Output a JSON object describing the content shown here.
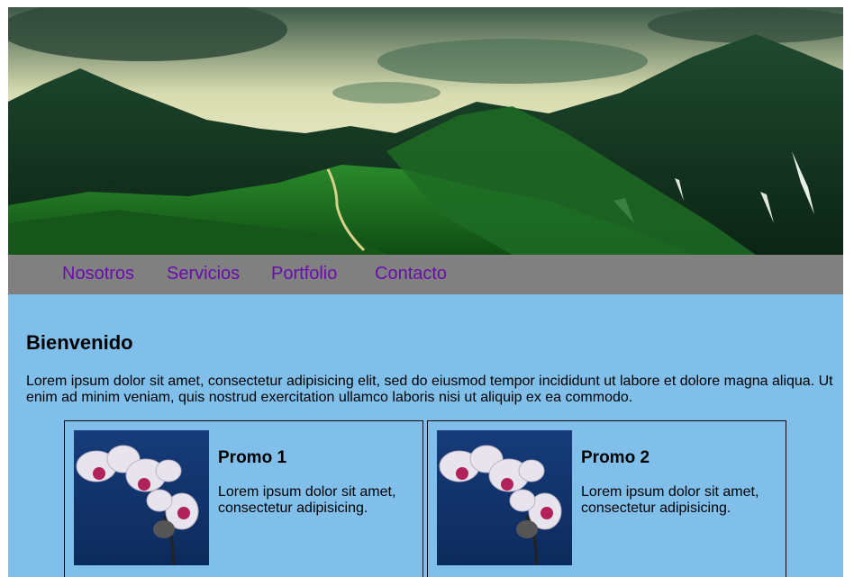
{
  "nav": {
    "items": [
      {
        "label": "Nosotros"
      },
      {
        "label": "Servicios"
      },
      {
        "label": "Portfolio"
      },
      {
        "label": "Contacto"
      }
    ]
  },
  "main": {
    "title": "Bienvenido",
    "intro": "Lorem ipsum dolor sit amet, consectetur adipisicing elit, sed do eiusmod tempor incididunt ut labore et dolore magna aliqua. Ut enim ad minim veniam, quis nostrud exercitation ullamco laboris nisi ut aliquip ex ea commodo."
  },
  "promos": [
    {
      "title": "Promo 1",
      "text": "Lorem ipsum dolor sit amet, consectetur adipisicing."
    },
    {
      "title": "Promo 2",
      "text": "Lorem ipsum dolor sit amet, consectetur adipisicing."
    }
  ],
  "colors": {
    "nav_bg": "#808080",
    "link": "#6a0dad",
    "main_bg": "#7fbfea"
  }
}
